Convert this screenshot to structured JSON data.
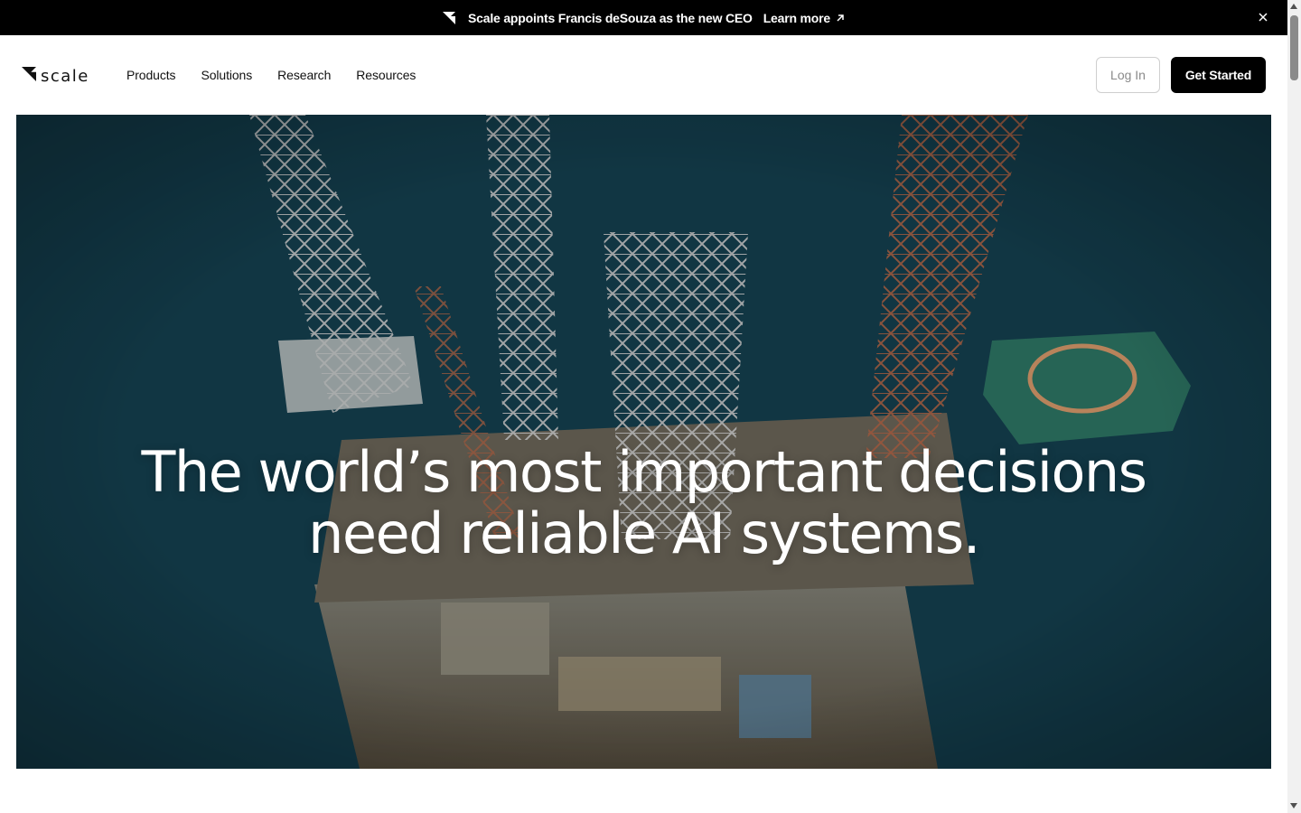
{
  "announcement": {
    "text": "Scale appoints Francis deSouza as the new CEO",
    "link_label": "Learn more"
  },
  "brand": {
    "wordmark": "scale"
  },
  "nav": {
    "items": [
      {
        "label": "Products"
      },
      {
        "label": "Solutions"
      },
      {
        "label": "Research"
      },
      {
        "label": "Resources"
      }
    ],
    "login_label": "Log In",
    "cta_label": "Get Started"
  },
  "hero": {
    "headline_line1": "The world’s most important decisions",
    "headline_line2": "need reliable AI systems."
  },
  "colors": {
    "announcement_bg": "#000000",
    "cta_bg": "#000000",
    "sea": "#174655"
  },
  "icons": [
    "scale-logo-icon",
    "arrow-up-right-icon",
    "close-icon"
  ]
}
